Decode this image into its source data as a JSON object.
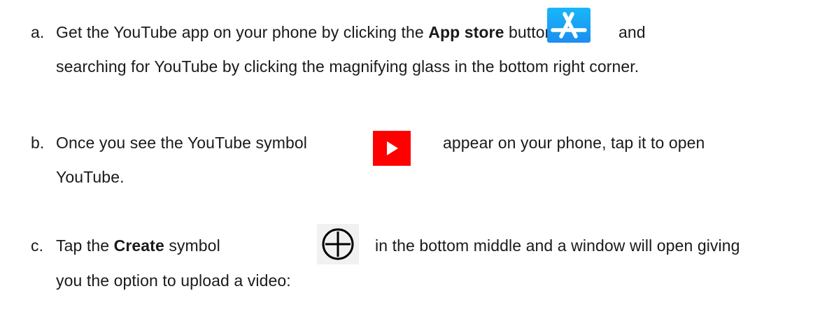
{
  "steps": [
    {
      "marker": "a.",
      "line1_pre": "Get the YouTube app on your phone by clicking the ",
      "line1_bold": "App store",
      "line1_post": " button",
      "line1_after_icon": "and",
      "line2": "searching for YouTube by clicking the magnifying glass in the bottom right corner.",
      "icon": "app-store-icon",
      "icon_color": "#1b96f3"
    },
    {
      "marker": "b.",
      "line1_pre": "Once you see the YouTube symbol",
      "line1_after_icon": "appear on your phone, tap it to open",
      "line2": "YouTube.",
      "icon": "youtube-play-icon",
      "icon_color": "#ff0000"
    },
    {
      "marker": "c.",
      "line1_pre": "Tap the ",
      "line1_bold": "Create",
      "line1_post": " symbol",
      "line1_after_icon": "in the bottom middle and a window will open giving",
      "line2": "you the option to upload a video:",
      "icon": "create-plus-icon",
      "icon_color": "#000000"
    }
  ]
}
